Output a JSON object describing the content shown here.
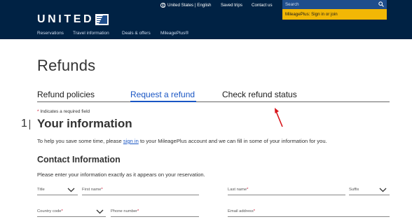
{
  "header": {
    "utility": {
      "language": "United States | English",
      "saved_trips": "Saved trips",
      "contact_us": "Contact us"
    },
    "search": {
      "placeholder": "Search"
    },
    "mileageplus": "MileagePlus: Sign in or join",
    "logo_text": "UNITED",
    "nav": [
      "Reservations",
      "Travel information",
      "Deals & offers",
      "MileagePlus®"
    ]
  },
  "main": {
    "title": "Refunds",
    "tabs": [
      {
        "label": "Refund policies",
        "active": false
      },
      {
        "label": "Request a refund",
        "active": true
      },
      {
        "label": "Check refund status",
        "active": false
      }
    ],
    "required_note": "Indicates a required field",
    "required_star": "*",
    "step": {
      "number": "1",
      "title": "Your information",
      "help_prefix": "To help you save some time, please",
      "help_link": "sign in",
      "help_suffix": "to your MileagePlus account and we can fill in some of your information for you."
    },
    "contact": {
      "title": "Contact Information",
      "description": "Please enter your information exactly as it appears on your reservation.",
      "fields": {
        "title": "Title",
        "first_name": "First name",
        "last_name": "Last name",
        "suffix": "Suffix",
        "country_code": "Country code",
        "phone_number": "Phone number",
        "email": "Email address"
      }
    }
  },
  "colors": {
    "header_bg": "#002244",
    "accent_link": "#1a56c4",
    "mileageplus_bg": "#f2b705",
    "required": "#c8102e",
    "annotation_arrow": "#d7141a"
  }
}
